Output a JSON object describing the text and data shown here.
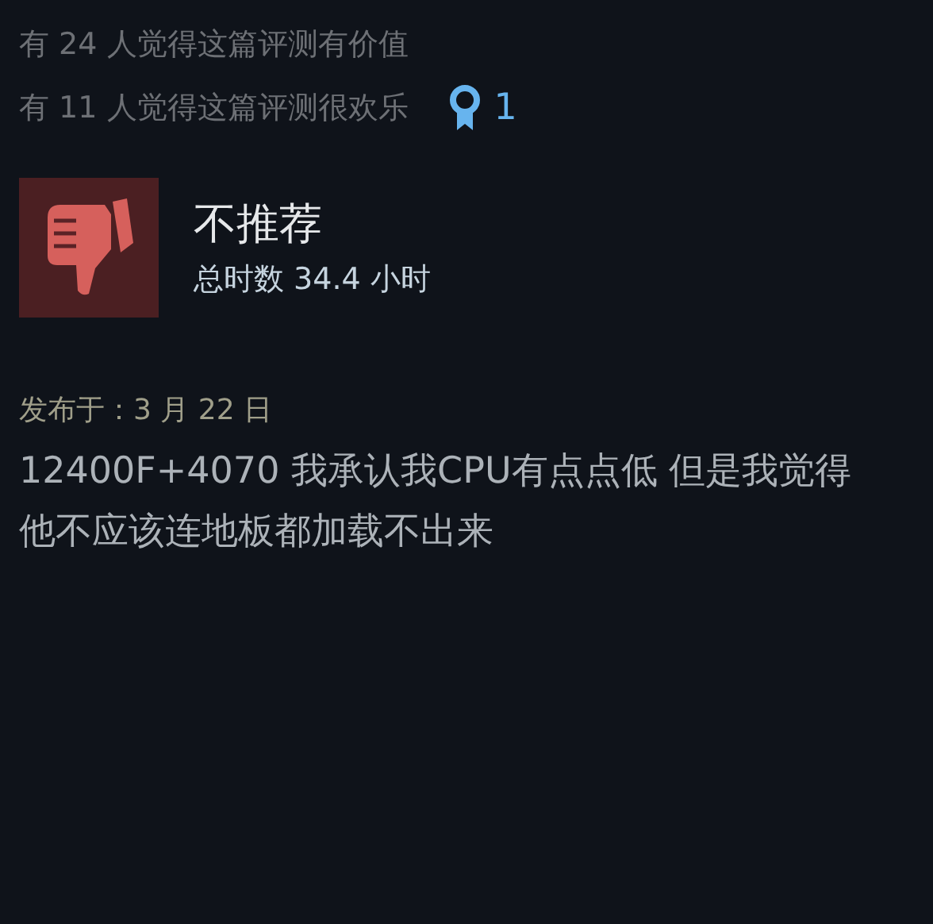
{
  "votes": [
    {
      "text": "有 24 人觉得这篇评测有价值"
    },
    {
      "text": "有 11 人觉得这篇评测很欢乐",
      "award_count": "1"
    }
  ],
  "review": {
    "recommended": false,
    "verdict": "不推荐",
    "hours": "总时数 34.4 小时",
    "posted": "发布于：3 月 22 日",
    "body": "12400F+4070 我承认我CPU有点点低 但是我觉得他不应该连地板都加载不出来"
  }
}
